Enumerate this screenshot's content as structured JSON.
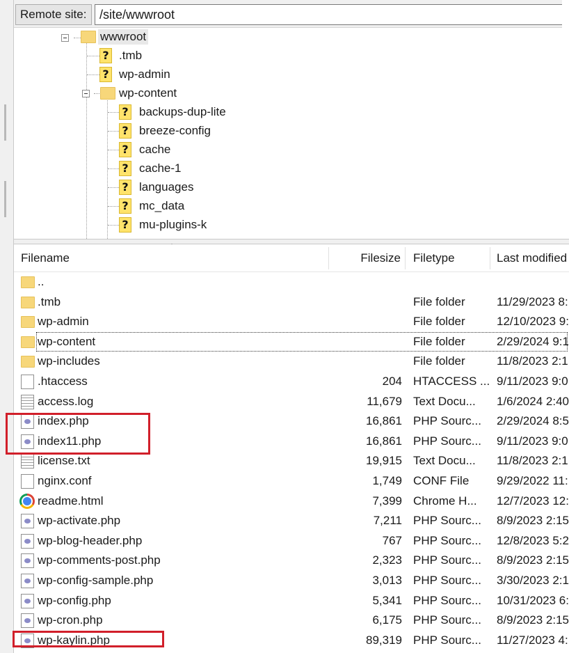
{
  "remote": {
    "label": "Remote site:",
    "path": "/site/wwwroot"
  },
  "tree": {
    "root": "wwwroot",
    "items": [
      {
        "label": ".tmb"
      },
      {
        "label": "wp-admin"
      },
      {
        "label": "wp-content"
      },
      {
        "label": "backups-dup-lite"
      },
      {
        "label": "breeze-config"
      },
      {
        "label": "cache"
      },
      {
        "label": "cache-1"
      },
      {
        "label": "languages"
      },
      {
        "label": "mc_data"
      },
      {
        "label": "mu-plugins-k"
      }
    ]
  },
  "columns": {
    "filename": "Filename",
    "filesize": "Filesize",
    "filetype": "Filetype",
    "modified": "Last modified"
  },
  "files": [
    {
      "name": "..",
      "size": "",
      "type": "",
      "modified": "",
      "icon": "folder-icon"
    },
    {
      "name": ".tmb",
      "size": "",
      "type": "File folder",
      "modified": "11/29/2023 8:",
      "icon": "folder-icon"
    },
    {
      "name": "wp-admin",
      "size": "",
      "type": "File folder",
      "modified": "12/10/2023 9:",
      "icon": "folder-icon"
    },
    {
      "name": "wp-content",
      "size": "",
      "type": "File folder",
      "modified": "2/29/2024 9:1",
      "icon": "folder-icon"
    },
    {
      "name": "wp-includes",
      "size": "",
      "type": "File folder",
      "modified": "11/8/2023 2:1",
      "icon": "folder-icon"
    },
    {
      "name": ".htaccess",
      "size": "204",
      "type": "HTACCESS ...",
      "modified": "9/11/2023 9:0",
      "icon": "file-icon"
    },
    {
      "name": "access.log",
      "size": "11,679",
      "type": "Text Docu...",
      "modified": "1/6/2024 2:40",
      "icon": "text-file-icon"
    },
    {
      "name": "index.php",
      "size": "16,861",
      "type": "PHP Sourc...",
      "modified": "2/29/2024 8:5",
      "icon": "php-file-icon"
    },
    {
      "name": "index11.php",
      "size": "16,861",
      "type": "PHP Sourc...",
      "modified": "9/11/2023 9:0",
      "icon": "php-file-icon"
    },
    {
      "name": "license.txt",
      "size": "19,915",
      "type": "Text Docu...",
      "modified": "11/8/2023 2:1",
      "icon": "text-file-icon"
    },
    {
      "name": "nginx.conf",
      "size": "1,749",
      "type": "CONF File",
      "modified": "9/29/2022 11:",
      "icon": "file-icon"
    },
    {
      "name": "readme.html",
      "size": "7,399",
      "type": "Chrome H...",
      "modified": "12/7/2023 12:",
      "icon": "chrome-icon"
    },
    {
      "name": "wp-activate.php",
      "size": "7,211",
      "type": "PHP Sourc...",
      "modified": "8/9/2023 2:15",
      "icon": "php-file-icon"
    },
    {
      "name": "wp-blog-header.php",
      "size": "767",
      "type": "PHP Sourc...",
      "modified": "12/8/2023 5:2",
      "icon": "php-file-icon"
    },
    {
      "name": "wp-comments-post.php",
      "size": "2,323",
      "type": "PHP Sourc...",
      "modified": "8/9/2023 2:15",
      "icon": "php-file-icon"
    },
    {
      "name": "wp-config-sample.php",
      "size": "3,013",
      "type": "PHP Sourc...",
      "modified": "3/30/2023 2:1",
      "icon": "php-file-icon"
    },
    {
      "name": "wp-config.php",
      "size": "5,341",
      "type": "PHP Sourc...",
      "modified": "10/31/2023 6:",
      "icon": "php-file-icon"
    },
    {
      "name": "wp-cron.php",
      "size": "6,175",
      "type": "PHP Sourc...",
      "modified": "8/9/2023 2:15",
      "icon": "php-file-icon"
    },
    {
      "name": "wp-kaylin.php",
      "size": "89,319",
      "type": "PHP Sourc...",
      "modified": "11/27/2023 4:",
      "icon": "php-file-icon"
    }
  ],
  "colors": {
    "highlight": "#d11f2a",
    "folder": "#f7d77a",
    "unknown_folder": "#ffe36b"
  }
}
